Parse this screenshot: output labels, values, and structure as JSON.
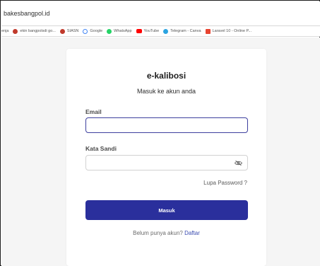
{
  "browser": {
    "address": "bakesbangpol.id",
    "bookmarks": [
      {
        "label": "enja",
        "icon": "none",
        "color": ""
      },
      {
        "label": "ekin bangpolsdi go...",
        "icon": "app-icon",
        "color": "#c0392b"
      },
      {
        "label": "SIASN",
        "icon": "app-icon",
        "color": "#c0392b"
      },
      {
        "label": "Google",
        "icon": "google-icon",
        "color": "#4285f4"
      },
      {
        "label": "WhatsApp",
        "icon": "whatsapp-icon",
        "color": "#25d366"
      },
      {
        "label": "YouTube",
        "icon": "youtube-icon",
        "color": "#ff0000"
      },
      {
        "label": "Telegram - Canva",
        "icon": "telegram-icon",
        "color": "#2aa3e0"
      },
      {
        "label": "Laravel 10 - Online P...",
        "icon": "laravel-icon",
        "color": "#e74430"
      }
    ]
  },
  "login": {
    "title": "e-kalibosi",
    "subtitle": "Masuk ke akun anda",
    "email_label": "Email",
    "email_value": "",
    "password_label": "Kata Sandi",
    "password_value": "",
    "forgot_label": "Lupa Password ?",
    "submit_label": "Masuk",
    "register_prompt": "Belum punya akun?",
    "register_link": "Daftar"
  },
  "colors": {
    "primary": "#2a2f9c",
    "link": "#3a4bb0",
    "page_bg": "#f5f5f5"
  }
}
